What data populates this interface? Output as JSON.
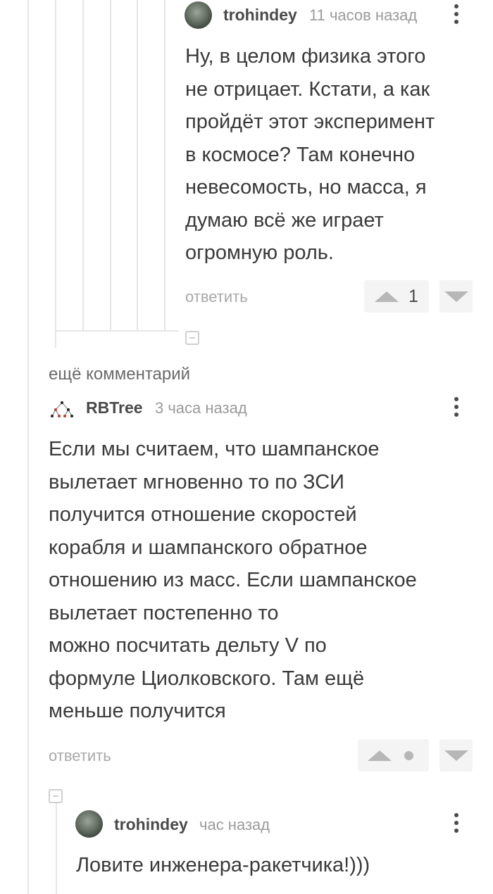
{
  "comment1": {
    "username": "trohindey",
    "time": "11 часов назад",
    "text": "Ну, в целом физика этого\nне отрицает. Кстати, а как\nпройдёт этот эксперимент\nв космосе? Там конечно\nневесомость, но масса, я\nдумаю всё же играет\nогромную роль.",
    "reply_label": "ответить",
    "rating": "1"
  },
  "more_comments_label": "ещё комментарий",
  "comment2": {
    "username": "RBTree",
    "time": "3 часа назад",
    "text": "Если мы считаем, что шампанское\nвылетает мгновенно то по ЗСИ\nполучится отношение скоростей\nкорабля и шампанского обратное\nотношению из масс. Если шампанское\nвылетает постепенно то\nможно посчитать дельту V по\nформуле Циолковского. Там ещё\nменьше получится",
    "reply_label": "ответить"
  },
  "comment3": {
    "username": "trohindey",
    "time": "час назад",
    "text": "Ловите инженера-ракетчика!)))"
  },
  "icons": {
    "kebab": "more-vertical-icon",
    "upvote": "arrow-up-icon",
    "downvote": "arrow-down-icon",
    "collapse": "minus-square-icon"
  }
}
